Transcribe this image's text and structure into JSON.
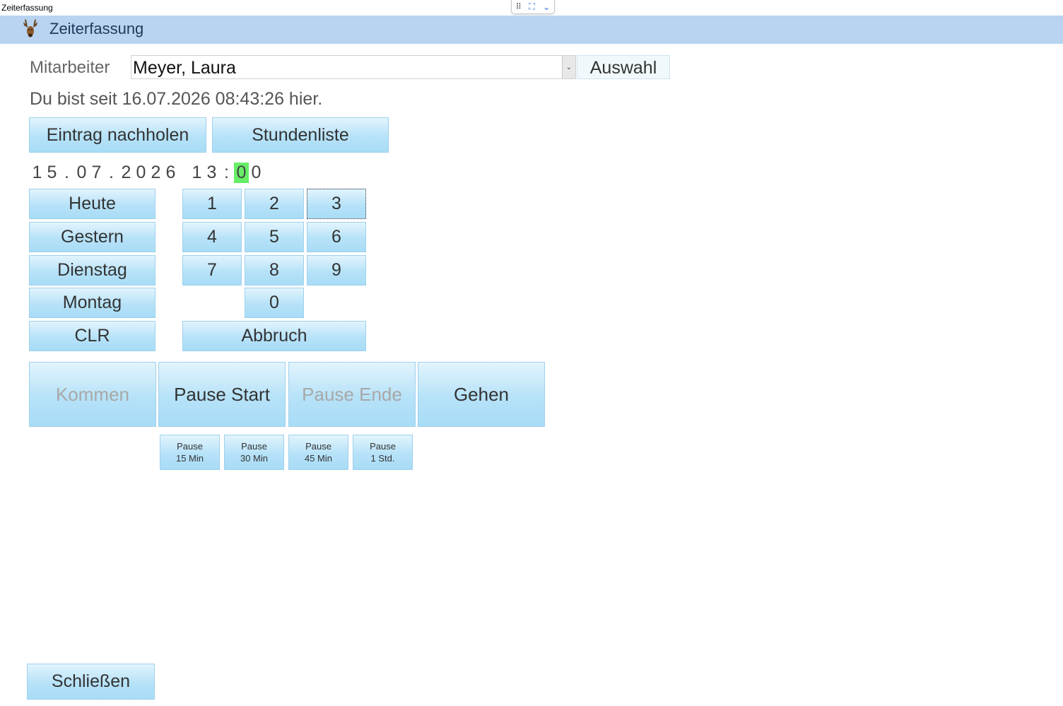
{
  "window": {
    "title": "Zeiterfassung"
  },
  "app": {
    "title": "Zeiterfassung",
    "logo_icon": "deer-head-icon",
    "bar_color": "#b8d4f0"
  },
  "employee": {
    "label": "Mitarbeiter",
    "selected": "Meyer, Laura",
    "select_button": "Auswahl"
  },
  "status": "Du bist seit 16.07.2026 08:43:26 hier.",
  "actions": {
    "backfill": "Eintrag nachholen",
    "hours_list": "Stundenliste"
  },
  "entry": {
    "date_chars": [
      "1",
      "5",
      ".",
      "0",
      "7",
      ".",
      "2",
      "0",
      "2",
      "6"
    ],
    "time_chars": [
      "1",
      "3",
      ":",
      "0",
      "0"
    ],
    "cursor_index": 3,
    "cursor_color": "#66ee66"
  },
  "day_buttons": [
    "Heute",
    "Gestern",
    "Dienstag",
    "Montag",
    "CLR"
  ],
  "keypad": {
    "keys": [
      "1",
      "2",
      "3",
      "4",
      "5",
      "6",
      "7",
      "8",
      "9",
      "0"
    ],
    "cancel": "Abbruch",
    "focused_key": "3"
  },
  "time_actions": {
    "come": {
      "label": "Kommen",
      "enabled": false
    },
    "pause_start": {
      "label": "Pause Start",
      "enabled": true
    },
    "pause_end": {
      "label": "Pause Ende",
      "enabled": false
    },
    "leave": {
      "label": "Gehen",
      "enabled": true
    }
  },
  "pause_presets": [
    {
      "line1": "Pause",
      "line2": "15 Min"
    },
    {
      "line1": "Pause",
      "line2": "30 Min"
    },
    {
      "line1": "Pause",
      "line2": "45 Min"
    },
    {
      "line1": "Pause",
      "line2": "1 Std."
    }
  ],
  "close_button": "Schließen"
}
